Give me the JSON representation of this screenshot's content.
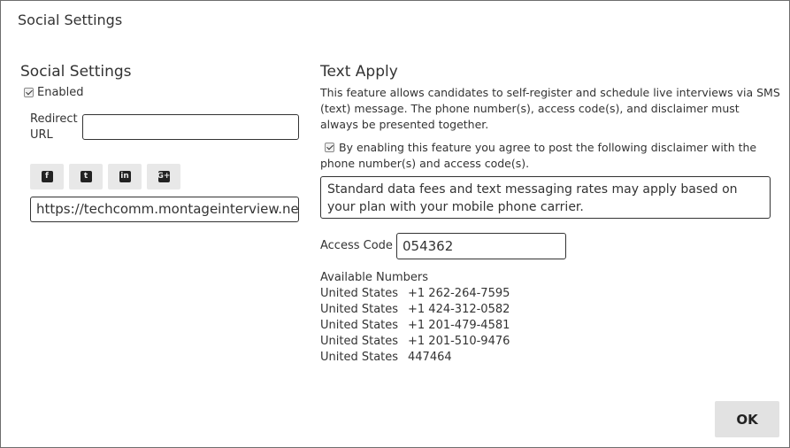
{
  "dialog": {
    "title": "Social Settings"
  },
  "social": {
    "heading": "Social Settings",
    "enabled_label": "Enabled",
    "redirect_label": "Redirect URL",
    "redirect_value": "",
    "share_buttons": [
      {
        "icon": "facebook-icon",
        "glyph": "f"
      },
      {
        "icon": "twitter-icon",
        "glyph": "t"
      },
      {
        "icon": "linkedin-icon",
        "glyph": "in"
      },
      {
        "icon": "google-plus-icon",
        "glyph": "G+"
      }
    ],
    "share_url": "https://techcomm.montageinterview.net."
  },
  "text_apply": {
    "heading": "Text Apply",
    "description": "This feature allows candidates to self-register and schedule live interviews via SMS (text) message. The phone number(s), access code(s), and disclaimer must always be presented together.",
    "agree_label": "By enabling this feature you agree to post the following disclaimer with the phone number(s) and access code(s).",
    "disclaimer": "Standard data fees and text messaging rates may apply based on your plan with your mobile phone carrier.",
    "access_code_label": "Access Code",
    "access_code_value": "054362",
    "numbers_heading": "Available Numbers",
    "numbers": [
      {
        "country": "United States",
        "number": "+1 262-264-7595"
      },
      {
        "country": "United States",
        "number": "+1 424-312-0582"
      },
      {
        "country": "United States",
        "number": "+1 201-479-4581"
      },
      {
        "country": "United States",
        "number": "+1 201-510-9476"
      },
      {
        "country": "United States",
        "number": "447464"
      }
    ]
  },
  "footer": {
    "ok_label": "OK"
  }
}
